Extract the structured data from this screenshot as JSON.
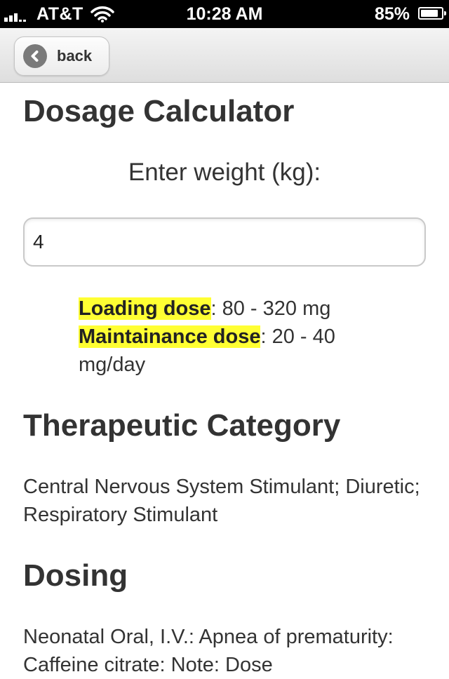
{
  "status_bar": {
    "carrier": "AT&T",
    "time": "10:28 AM",
    "battery_percent": "85%",
    "battery_level": 0.85,
    "icons": [
      "signal-icon",
      "wifi-icon",
      "battery-icon"
    ]
  },
  "header": {
    "back_label": "back",
    "back_icon": "chevron-left-icon"
  },
  "calculator": {
    "title": "Dosage Calculator",
    "prompt": "Enter weight (kg):",
    "weight_value": "4",
    "loading_label": "Loading dose",
    "loading_value": ": 80 - 320 mg",
    "maintenance_label": "Maintainance dose",
    "maintenance_value": ": 20 - 40 mg/day"
  },
  "therapeutic": {
    "title": "Therapeutic Category",
    "text": "Central Nervous System Stimulant; Diuretic; Respiratory Stimulant"
  },
  "dosing": {
    "title": "Dosing",
    "text": "Neonatal Oral, I.V.: Apnea of prematurity: Caffeine citrate: Note: Dose"
  },
  "colors": {
    "highlight": "#ffff33",
    "text": "#333333",
    "status_bar_bg": "#000000"
  }
}
